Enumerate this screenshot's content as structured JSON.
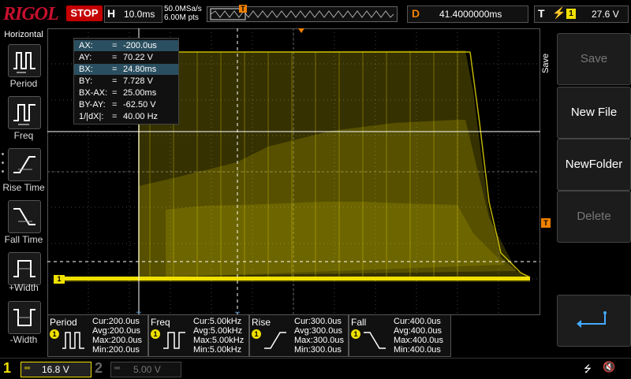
{
  "brand": {
    "logo": "RIGOL"
  },
  "topbar": {
    "run_state": "STOP",
    "timebase_label": "H",
    "timebase_value": "10.0ms",
    "sample_rate": "50.0MSa/s",
    "mem_depth": "6.00M pts",
    "trigger_pos_marker": "T",
    "delay_label": "D",
    "delay_value": "41.4000000ms",
    "trigger_label": "T",
    "trigger_source": "1",
    "trigger_level": "27.6 V"
  },
  "left_menu": {
    "title": "Horizontal",
    "items": [
      {
        "label": "Period",
        "icon": "period-icon"
      },
      {
        "label": "Freq",
        "icon": "freq-icon"
      },
      {
        "label": "Rise Time",
        "icon": "rise-time-icon"
      },
      {
        "label": "Fall Time",
        "icon": "fall-time-icon"
      },
      {
        "label": "+Width",
        "icon": "pos-width-icon"
      },
      {
        "label": "-Width",
        "icon": "neg-width-icon"
      }
    ]
  },
  "cursor_table": {
    "rows": [
      {
        "key": "AX:",
        "eq": "=",
        "value": "-200.0us",
        "highlight": true
      },
      {
        "key": "AY:",
        "eq": "=",
        "value": "70.22 V",
        "highlight": false
      },
      {
        "key": "BX:",
        "eq": "=",
        "value": "24.80ms",
        "highlight": true
      },
      {
        "key": "BY:",
        "eq": "=",
        "value": "7.728 V",
        "highlight": false
      },
      {
        "key": "BX-AX:",
        "eq": "=",
        "value": "25.00ms",
        "highlight": false
      },
      {
        "key": "BY-AY:",
        "eq": "=",
        "value": "-62.50 V",
        "highlight": false
      },
      {
        "key": "1/|dX|:",
        "eq": "=",
        "value": "40.00 Hz",
        "highlight": false
      }
    ]
  },
  "markers": {
    "trigger_level": "T",
    "channel_ground": "1"
  },
  "right_menu": {
    "side_label": "Save",
    "buttons": [
      {
        "label": "Save",
        "enabled": false
      },
      {
        "label": "New File",
        "enabled": true
      },
      {
        "label": "NewFolder",
        "enabled": true
      },
      {
        "label": "Delete",
        "enabled": false
      }
    ],
    "back_icon": "return-arrow-icon"
  },
  "measurements": [
    {
      "title": "Period",
      "channel": "1",
      "icon": "period-icon",
      "cur": "Cur:200.0us",
      "avg": "Avg:200.0us",
      "max": "Max:200.0us",
      "min": "Min:200.0us"
    },
    {
      "title": "Freq",
      "channel": "1",
      "icon": "freq-icon",
      "cur": "Cur:5.00kHz",
      "avg": "Avg:5.00kHz",
      "max": "Max:5.00kHz",
      "min": "Min:5.00kHz"
    },
    {
      "title": "Rise",
      "channel": "1",
      "icon": "rise-time-icon",
      "cur": "Cur:300.0us",
      "avg": "Avg:300.0us",
      "max": "Max:300.0us",
      "min": "Min:300.0us"
    },
    {
      "title": "Fall",
      "channel": "1",
      "icon": "fall-time-icon",
      "cur": "Cur:400.0us",
      "avg": "Avg:400.0us",
      "max": "Max:400.0us",
      "min": "Min:400.0us"
    }
  ],
  "bottombar": {
    "ch1_number": "1",
    "ch1_scale": "16.8 V",
    "ch2_number": "2",
    "ch2_scale": "5.00 V"
  },
  "colors": {
    "ch1": "#f0e000",
    "accent": "#f08000",
    "stop": "#c40000",
    "logo": "#c8102e",
    "highlight": "#2a4f60"
  }
}
